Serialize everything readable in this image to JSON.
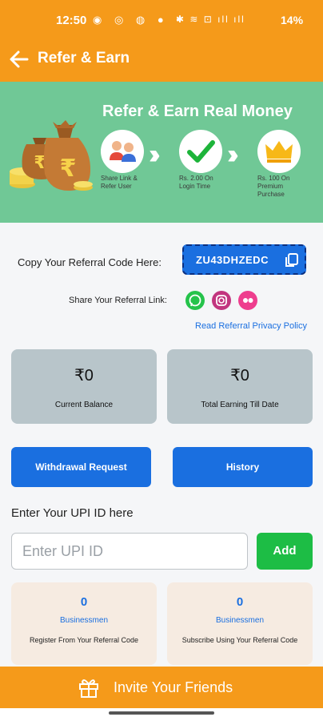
{
  "status_bar": {
    "time": "12:50",
    "left_icons": "◉ ◎ ◍ ● •",
    "right_icons": "✱ ≋ ⊡ ıll ıll",
    "battery": "14%"
  },
  "app_bar": {
    "title": "Refer & Earn",
    "back_icon": "arrow-left-icon"
  },
  "banner": {
    "title": "Refer & Earn Real Money",
    "steps": [
      {
        "caption": "Share Link & Refer User",
        "icon": "people-icon"
      },
      {
        "caption": "Rs. 2.00 On Login Time",
        "icon": "checkmark-icon"
      },
      {
        "caption": "Rs. 100 On Premium Purchase",
        "icon": "crown-icon"
      }
    ],
    "colors": {
      "background": "#70c896",
      "check": "#1db43a",
      "crown": "#f7b818"
    }
  },
  "referral": {
    "label": "Copy Your Referral Code Here:",
    "code": "ZU43DHZEDC",
    "share_label": "Share Your Referral Link:",
    "share_icons": [
      "whatsapp-icon",
      "instagram-icon",
      "flickr-icon"
    ],
    "privacy_link": "Read Referral Privacy Policy"
  },
  "stats": [
    {
      "value": "₹0",
      "label": "Current Balance"
    },
    {
      "value": "₹0",
      "label": "Total Earning Till Date"
    }
  ],
  "buttons": {
    "withdrawal": "Withdrawal Request",
    "history": "History"
  },
  "upi": {
    "label": "Enter Your UPI ID here",
    "placeholder": "Enter UPI ID",
    "add_label": "Add"
  },
  "info_cards": [
    {
      "count": "0",
      "type": "Businessmen",
      "desc": "Register From Your Referral Code"
    },
    {
      "count": "0",
      "type": "Businessmen",
      "desc": "Subscribe Using Your Referral Code"
    }
  ],
  "invite": {
    "label": "Invite Your Friends",
    "icon": "gift-icon"
  },
  "colors": {
    "primary_orange": "#f59a1a",
    "primary_blue": "#1a6fe0",
    "green": "#1dbd45"
  }
}
